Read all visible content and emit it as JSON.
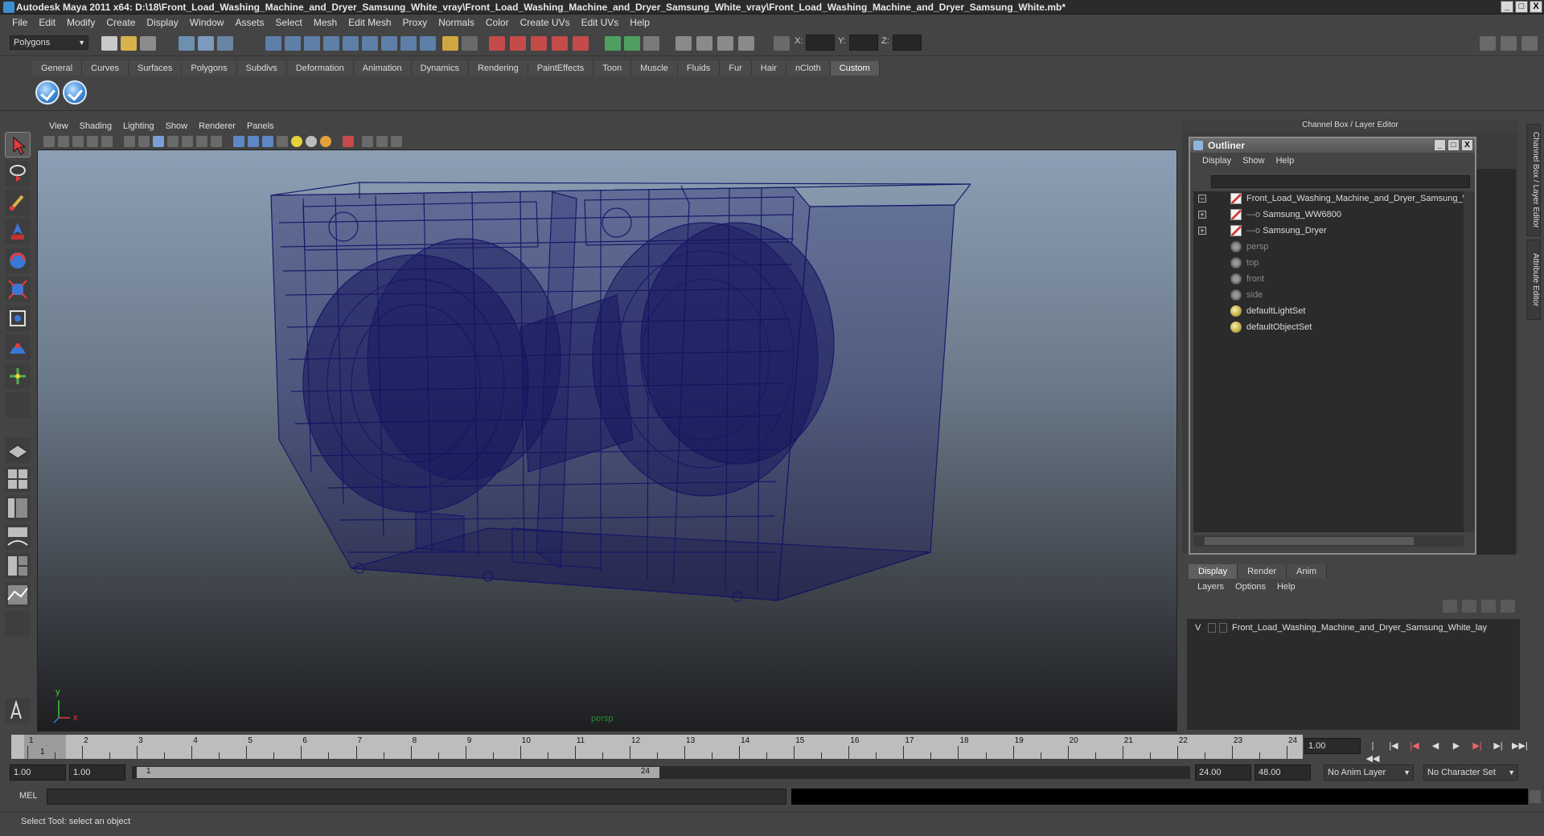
{
  "window": {
    "title": "Autodesk Maya 2011 x64: D:\\18\\Front_Load_Washing_Machine_and_Dryer_Samsung_White_vray\\Front_Load_Washing_Machine_and_Dryer_Samsung_White_vray\\Front_Load_Washing_Machine_and_Dryer_Samsung_White.mb*",
    "minimize": "_",
    "maximize": "□",
    "close": "X"
  },
  "menubar": [
    "File",
    "Edit",
    "Modify",
    "Create",
    "Display",
    "Window",
    "Assets",
    "Select",
    "Mesh",
    "Edit Mesh",
    "Proxy",
    "Normals",
    "Color",
    "Create UVs",
    "Edit UVs",
    "Help"
  ],
  "statusline": {
    "mode": "Polygons",
    "x_label": "X:",
    "y_label": "Y:",
    "z_label": "Z:"
  },
  "shelf": {
    "tabs": [
      "General",
      "Curves",
      "Surfaces",
      "Polygons",
      "Subdivs",
      "Deformation",
      "Animation",
      "Dynamics",
      "Rendering",
      "PaintEffects",
      "Toon",
      "Muscle",
      "Fluids",
      "Fur",
      "Hair",
      "nCloth",
      "Custom"
    ],
    "active_tab": "Custom"
  },
  "viewport": {
    "menu": [
      "View",
      "Shading",
      "Lighting",
      "Show",
      "Renderer",
      "Panels"
    ],
    "camera": "persp",
    "axis_y": "y",
    "axis_x": "x"
  },
  "channel_box": {
    "header": "Channel Box / Layer Editor"
  },
  "outliner": {
    "title": "Outliner",
    "menu": [
      "Display",
      "Show",
      "Help"
    ],
    "items": [
      {
        "label": "Front_Load_Washing_Machine_and_Dryer_Samsung_W",
        "type": "mesh",
        "dim": false,
        "expander": "−"
      },
      {
        "label": "Samsung_WW6800",
        "type": "mesh",
        "dim": false,
        "expander": "+"
      },
      {
        "label": "Samsung_Dryer",
        "type": "mesh",
        "dim": false,
        "expander": "+"
      },
      {
        "label": "persp",
        "type": "cam",
        "dim": true
      },
      {
        "label": "top",
        "type": "cam",
        "dim": true
      },
      {
        "label": "front",
        "type": "cam",
        "dim": true
      },
      {
        "label": "side",
        "type": "cam",
        "dim": true
      },
      {
        "label": "defaultLightSet",
        "type": "set",
        "dim": false
      },
      {
        "label": "defaultObjectSet",
        "type": "set",
        "dim": false
      }
    ]
  },
  "side_tabs": [
    "Channel Box / Layer Editor",
    "Attribute Editor"
  ],
  "layer_editor": {
    "tabs": [
      "Display",
      "Render",
      "Anim"
    ],
    "active_tab": "Display",
    "menu": [
      "Layers",
      "Options",
      "Help"
    ],
    "layer_visible": "V",
    "layer_name": "Front_Load_Washing_Machine_and_Dryer_Samsung_White_lay"
  },
  "timeline": {
    "ticks": [
      "1",
      "2",
      "3",
      "4",
      "5",
      "6",
      "7",
      "8",
      "9",
      "10",
      "11",
      "12",
      "13",
      "14",
      "15",
      "16",
      "17",
      "18",
      "19",
      "20",
      "21",
      "22",
      "23",
      "24"
    ],
    "current_frame_label": "1",
    "current_time": "1.00"
  },
  "range": {
    "start": "1.00",
    "playback_start": "1.00",
    "slider_start": "1",
    "slider_end": "24",
    "playback_end": "24.00",
    "end": "48.00",
    "anim_layer": "No Anim Layer",
    "character_set": "No Character Set"
  },
  "command_line": {
    "label": "MEL"
  },
  "help_line": "Select Tool: select an object"
}
